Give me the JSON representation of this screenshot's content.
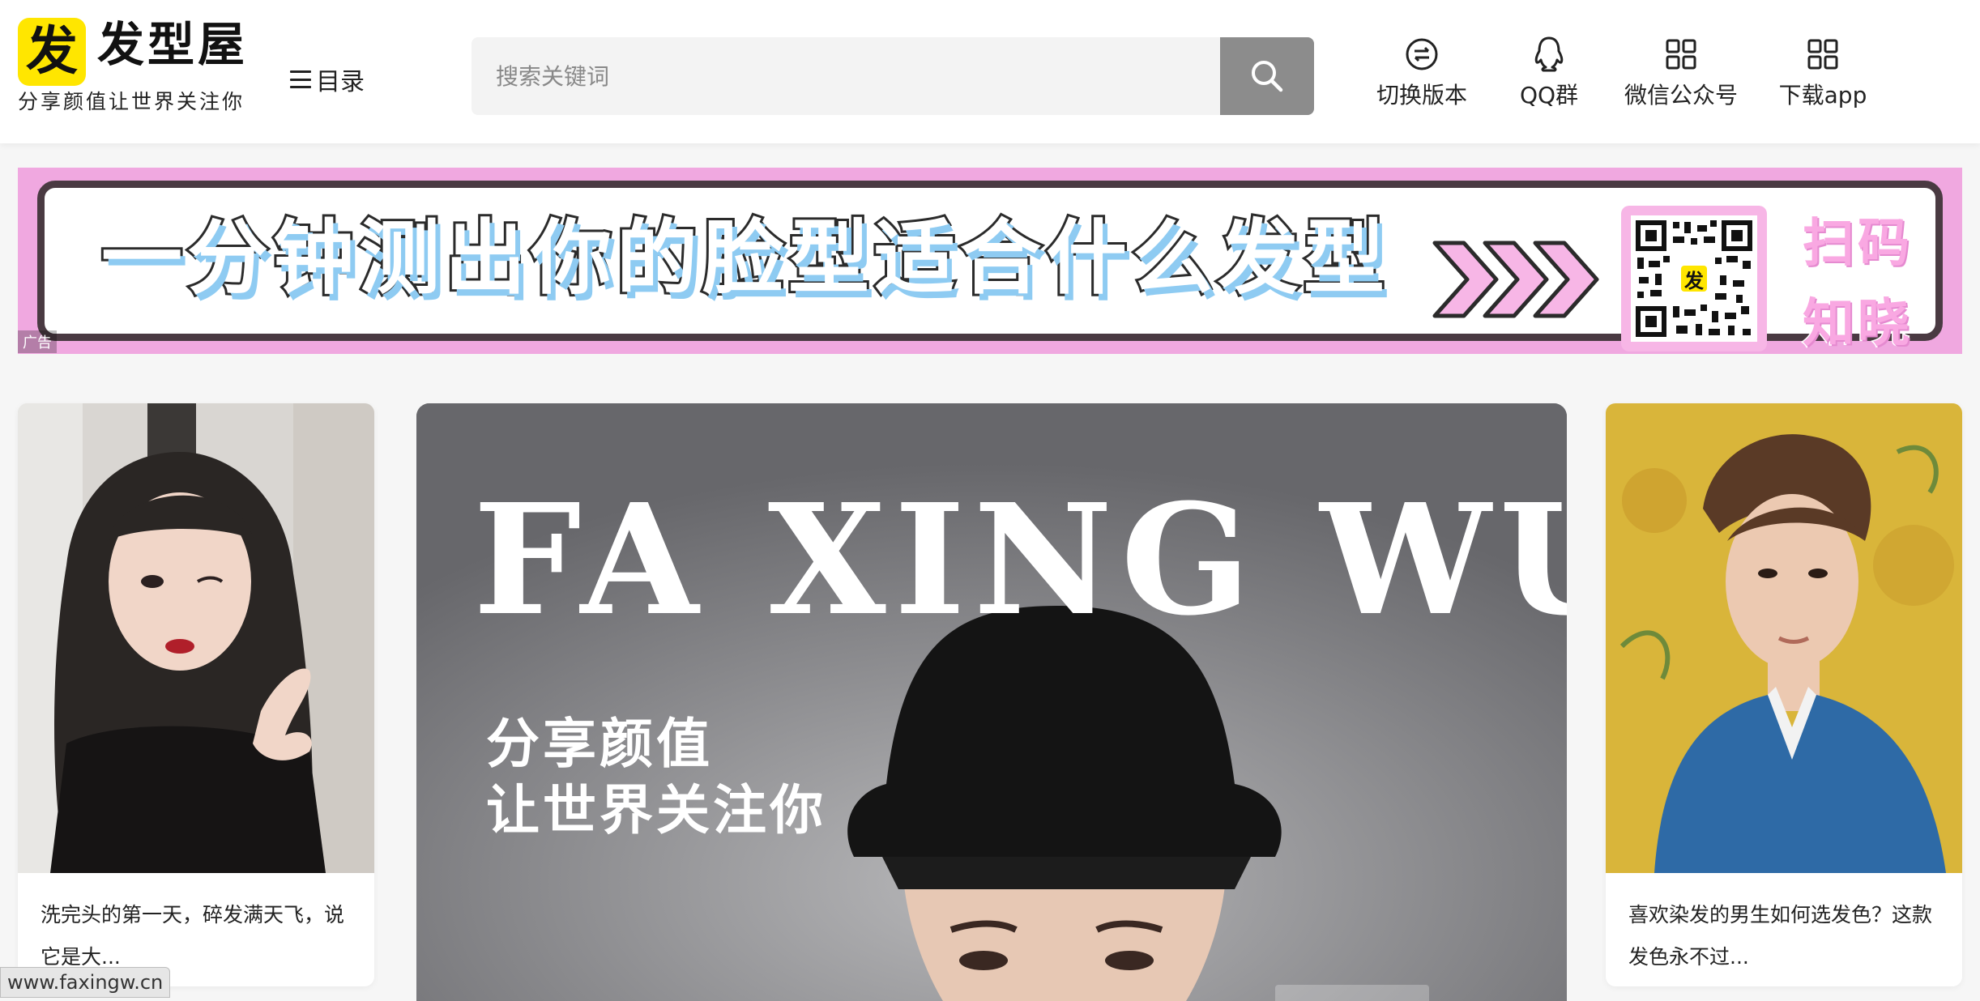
{
  "header": {
    "logo_glyph": "发",
    "logo_name": "发型屋",
    "slogan": "分享颜值让世界关注你",
    "menu_label": "目录",
    "search": {
      "placeholder": "搜索关键词",
      "value": ""
    },
    "nav": [
      {
        "label": "切换版本",
        "icon": "switch-icon"
      },
      {
        "label": "QQ群",
        "icon": "qq-icon"
      },
      {
        "label": "微信公众号",
        "icon": "grid-icon"
      },
      {
        "label": "下载app",
        "icon": "grid-icon"
      }
    ]
  },
  "banner": {
    "headline": "一分钟测出你的脸型适合什么发型",
    "qr_badge": "发",
    "scan_text_line1": "扫码",
    "scan_text_line2": "知晓",
    "ad_label": "广告",
    "colors": {
      "background": "#f0a8e0",
      "border": "#4a3a42",
      "text_shadow": "#8ecbf2"
    }
  },
  "cards": {
    "left": {
      "caption": "洗完头的第一天，碎发满天飞，说它是大..."
    },
    "hero": {
      "title": "FA XING WU",
      "slogan_line1": "分享颜值",
      "slogan_line2": "让世界关注你"
    },
    "right": {
      "caption": "喜欢染发的男生如何选发色？这款发色永不过..."
    }
  },
  "status_bar": {
    "url": "www.faxingw.cn"
  }
}
